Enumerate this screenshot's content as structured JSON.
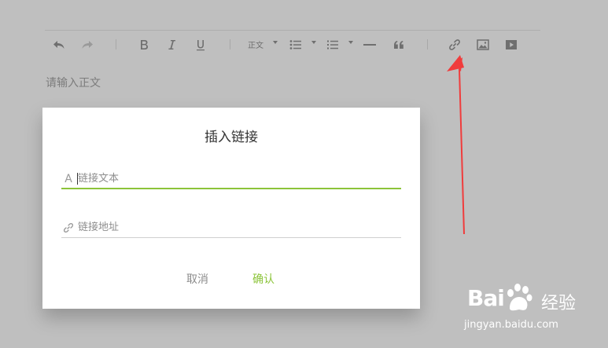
{
  "editor": {
    "placeholder": "请输入正文",
    "paragraph_select": "正文"
  },
  "dialog": {
    "title": "插入链接",
    "text_field": {
      "placeholder": "链接文本",
      "value": "",
      "icon_label": "A"
    },
    "url_field": {
      "placeholder": "链接地址",
      "value": ""
    },
    "cancel_label": "取消",
    "confirm_label": "确认"
  },
  "watermark": {
    "brand": "Bai",
    "brand_suffix": "经验",
    "url": "jingyan.baidu.com"
  },
  "colors": {
    "accent": "#8cc43a",
    "overlay": "#bfbfbf",
    "arrow": "#f03c3c"
  }
}
